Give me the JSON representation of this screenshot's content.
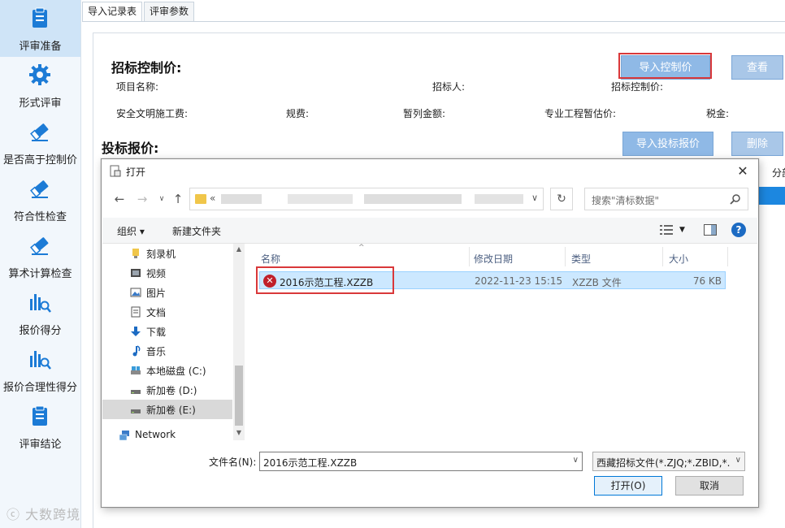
{
  "sidebar": {
    "items": [
      {
        "label": "评审准备",
        "icon": "clipboard-icon"
      },
      {
        "label": "形式评审",
        "icon": "gear-icon"
      },
      {
        "label": "是否高于控制价",
        "icon": "eraser-icon"
      },
      {
        "label": "符合性检查",
        "icon": "eraser-icon"
      },
      {
        "label": "算术计算检查",
        "icon": "eraser-icon"
      },
      {
        "label": "报价得分",
        "icon": "chart-search-icon"
      },
      {
        "label": "报价合理性得分",
        "icon": "chart-search-icon"
      },
      {
        "label": "评审结论",
        "icon": "clipboard-icon"
      }
    ]
  },
  "tabs": [
    "导入记录表",
    "评审参数"
  ],
  "control_price": {
    "title": "招标控制价:",
    "import_button": "导入控制价",
    "view_button": "查看",
    "fields": {
      "project_name": "项目名称:",
      "tenderer": "招标人:",
      "control_price": "招标控制价:",
      "safety_fee": "安全文明施工费:",
      "regulation_fee": "规费:",
      "provisional_sum": "暂列金额:",
      "provisional_estimate": "专业工程暂估价:",
      "tax": "税金:"
    }
  },
  "bid_quote": {
    "title": "投标报价:",
    "import_button": "导入投标报价",
    "delete_button": "删除",
    "right_header_fragment": "分部"
  },
  "dialog": {
    "title": "打开",
    "address_prefix": "«",
    "search_placeholder": "搜索\"清标数据\"",
    "toolbar": {
      "organize": "组织 ▾",
      "new_folder": "新建文件夹"
    },
    "tree": [
      {
        "label": "刻录机",
        "icon": "burner-icon"
      },
      {
        "label": "视频",
        "icon": "video-icon"
      },
      {
        "label": "图片",
        "icon": "picture-icon"
      },
      {
        "label": "文档",
        "icon": "document-icon"
      },
      {
        "label": "下载",
        "icon": "download-icon"
      },
      {
        "label": "音乐",
        "icon": "music-icon"
      },
      {
        "label": "本地磁盘 (C:)",
        "icon": "drive-icon"
      },
      {
        "label": "新加卷 (D:)",
        "icon": "drive-icon"
      },
      {
        "label": "新加卷 (E:)",
        "icon": "drive-icon"
      },
      {
        "label": "Network",
        "icon": "network-icon"
      }
    ],
    "columns": [
      "名称",
      "修改日期",
      "类型",
      "大小"
    ],
    "files": [
      {
        "name": "2016示范工程.XZZB",
        "modified": "2022-11-23 15:15",
        "type": "XZZB 文件",
        "size": "76 KB"
      }
    ],
    "filename_label": "文件名(N):",
    "filename_value": "2016示范工程.XZZB",
    "filter_value": "西藏招标文件(*.ZJQ;*.ZBID,*.X",
    "open_button": "打开(O)",
    "cancel_button": "取消"
  },
  "watermark": "大数跨境",
  "colors": {
    "accent": "#8fb9e6",
    "highlight": "#d9383a",
    "selection": "#cce8ff"
  }
}
